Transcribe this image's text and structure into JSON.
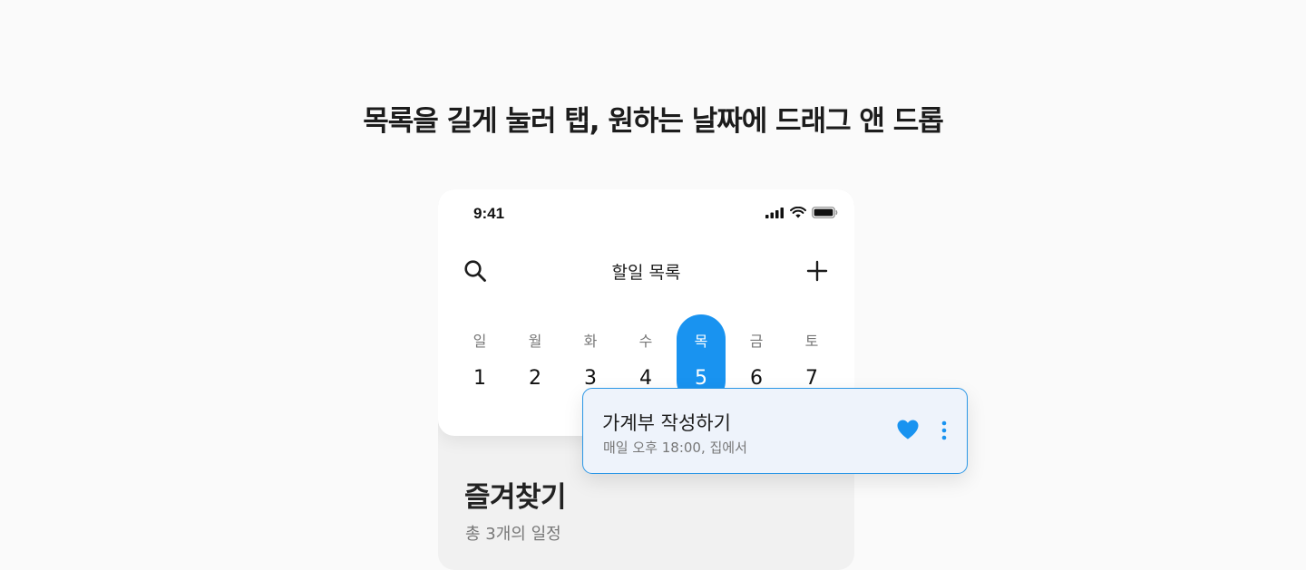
{
  "headline": "목록을 길게 눌러 탭, 원하는 날짜에 드래그 앤 드롭",
  "status_bar": {
    "time": "9:41",
    "icons": [
      "signal-icon",
      "wifi-icon",
      "battery-icon"
    ]
  },
  "nav": {
    "title": "할일 목록",
    "search_icon": "search-icon",
    "add_icon": "plus-icon"
  },
  "week": {
    "selected_index": 4,
    "days": [
      {
        "dow": "일",
        "num": "1"
      },
      {
        "dow": "월",
        "num": "2"
      },
      {
        "dow": "화",
        "num": "3"
      },
      {
        "dow": "수",
        "num": "4"
      },
      {
        "dow": "목",
        "num": "5"
      },
      {
        "dow": "금",
        "num": "6"
      },
      {
        "dow": "토",
        "num": "7"
      }
    ]
  },
  "favorites": {
    "title": "즐겨찾기",
    "count_text": "총 3개의 일정"
  },
  "dragged_item": {
    "title": "가계부 작성하기",
    "subtitle": "매일 오후 18:00, 집에서",
    "heart_icon": "heart-icon",
    "more_icon": "more-vertical-icon"
  },
  "colors": {
    "accent": "#1993f0",
    "card_border": "#2a96e6",
    "card_bg": "#eef3fb",
    "page_bg": "#fafafa"
  }
}
